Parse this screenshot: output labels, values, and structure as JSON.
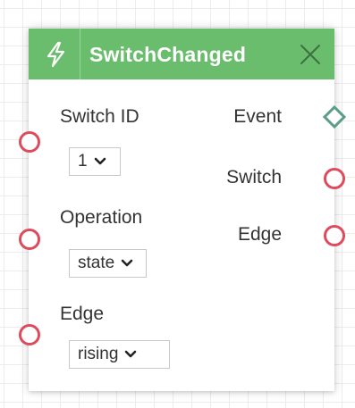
{
  "node": {
    "title": "SwitchChanged",
    "header_color": "#6bbd6e",
    "header_icon": "bolt-icon",
    "close_icon": "close-icon"
  },
  "inputs": [
    {
      "label": "Switch ID",
      "value": "1"
    },
    {
      "label": "Operation",
      "value": "state"
    },
    {
      "label": "Edge",
      "value": "rising"
    }
  ],
  "outputs": [
    {
      "label": "Event",
      "port_shape": "diamond",
      "port_color": "#5b9e88"
    },
    {
      "label": "Switch",
      "port_shape": "circle",
      "port_color": "#dc4c5c"
    },
    {
      "label": "Edge",
      "port_shape": "circle",
      "port_color": "#dc4c5c"
    }
  ]
}
